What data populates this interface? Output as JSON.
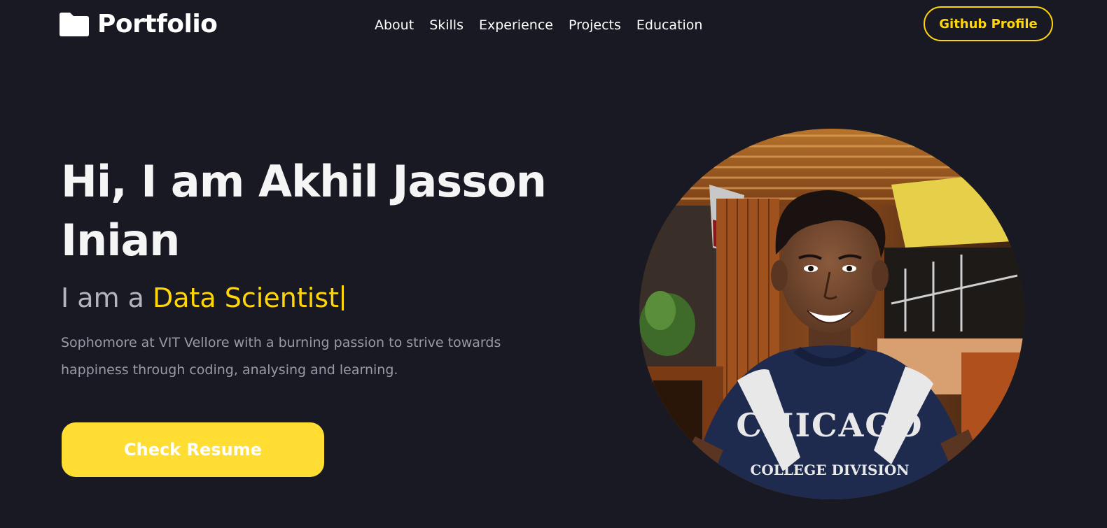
{
  "navbar": {
    "logo_text": "Portfolio",
    "logo_icon": "folder-icon",
    "links": [
      {
        "label": "About"
      },
      {
        "label": "Skills"
      },
      {
        "label": "Experience"
      },
      {
        "label": "Projects"
      },
      {
        "label": "Education"
      }
    ],
    "github_button": "Github Profile"
  },
  "hero": {
    "title": "Hi, I am Akhil Jasson Inian",
    "role_prefix": "I am a",
    "role_value": "Data Scientist",
    "description": "Sophomore at VIT Vellore with a burning passion to strive towards happiness through coding, analysing and learning.",
    "resume_button": "Check Resume",
    "profile_photo_shirt_text": "CHICAGO",
    "profile_photo_shirt_subtext": "COLLEGE DIVISION"
  },
  "colors": {
    "background": "#191923",
    "accent": "#ffd60a",
    "button_fill": "#ffdd33",
    "text_primary": "#ffffff",
    "text_muted": "#9a9aa5"
  }
}
